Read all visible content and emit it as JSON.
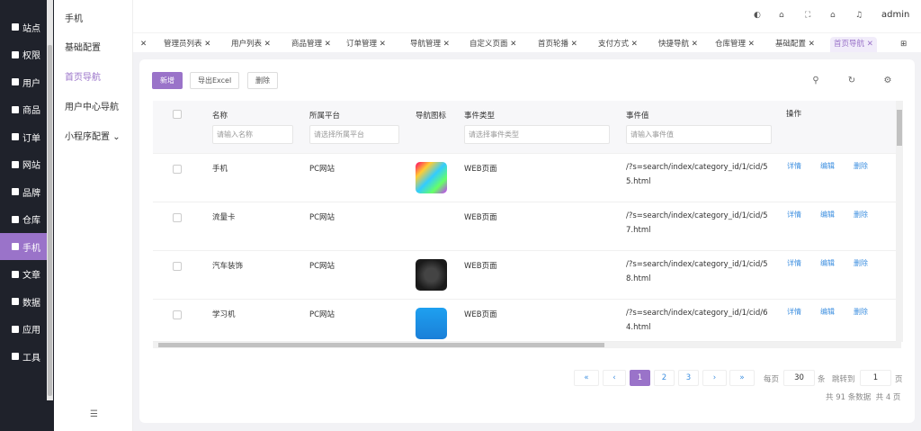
{
  "sidebar": {
    "items": [
      {
        "label": "站点"
      },
      {
        "label": "权限"
      },
      {
        "label": "用户"
      },
      {
        "label": "商品"
      },
      {
        "label": "订单"
      },
      {
        "label": "网站"
      },
      {
        "label": "品牌"
      },
      {
        "label": "仓库"
      },
      {
        "label": "手机",
        "active": true
      },
      {
        "label": "文章"
      },
      {
        "label": "数据"
      },
      {
        "label": "应用"
      },
      {
        "label": "工具"
      }
    ]
  },
  "submenu": {
    "title": "手机",
    "items": [
      {
        "label": "基础配置"
      },
      {
        "label": "首页导航",
        "active": true
      },
      {
        "label": "用户中心导航"
      },
      {
        "label": "小程序配置"
      }
    ]
  },
  "header": {
    "user": "admin"
  },
  "tabs": [
    "管理员列表",
    "用户列表",
    "商品管理",
    "订单管理",
    "导航管理",
    "自定义页面",
    "首页轮播",
    "支付方式",
    "快捷导航",
    "仓库管理",
    "基础配置",
    "首页导航"
  ],
  "toolbar": {
    "add": "新增",
    "export": "导出Excel",
    "delete": "删除"
  },
  "table": {
    "columns": {
      "name": "名称",
      "platform": "所属平台",
      "icon": "导航图标",
      "event_type": "事件类型",
      "event_value": "事件值",
      "actions": "操作"
    },
    "filters": {
      "name": "请输入名称",
      "platform": "请选择所属平台",
      "event_type": "请选择事件类型",
      "event_value": "请输入事件值"
    },
    "rows": [
      {
        "name": "手机",
        "platform": "PC网站",
        "event_type": "WEB页面",
        "event_value_1": "/?s=search/index/category_id/1/cid/5",
        "event_value_2": "5.html"
      },
      {
        "name": "流量卡",
        "platform": "PC网站",
        "event_type": "WEB页面",
        "event_value_1": "/?s=search/index/category_id/1/cid/5",
        "event_value_2": "7.html"
      },
      {
        "name": "汽车装饰",
        "platform": "PC网站",
        "event_type": "WEB页面",
        "event_value_1": "/?s=search/index/category_id/1/cid/5",
        "event_value_2": "8.html"
      },
      {
        "name": "学习机",
        "platform": "PC网站",
        "event_type": "WEB页面",
        "event_value_1": "/?s=search/index/category_id/1/cid/6",
        "event_value_2": "4.html"
      }
    ],
    "actions": {
      "detail": "详情",
      "edit": "编辑",
      "delete": "删除"
    }
  },
  "pagination": {
    "first": "«",
    "prev": "‹",
    "pages": [
      "1",
      "2",
      "3"
    ],
    "current": "1",
    "next": "›",
    "last": "»",
    "per_page_label": "每页",
    "per_page": "30",
    "unit": "条",
    "jump_label": "跳转到",
    "jump_value": "1",
    "page_unit": "页",
    "summary": "共 91 条数据  共 4 页"
  }
}
